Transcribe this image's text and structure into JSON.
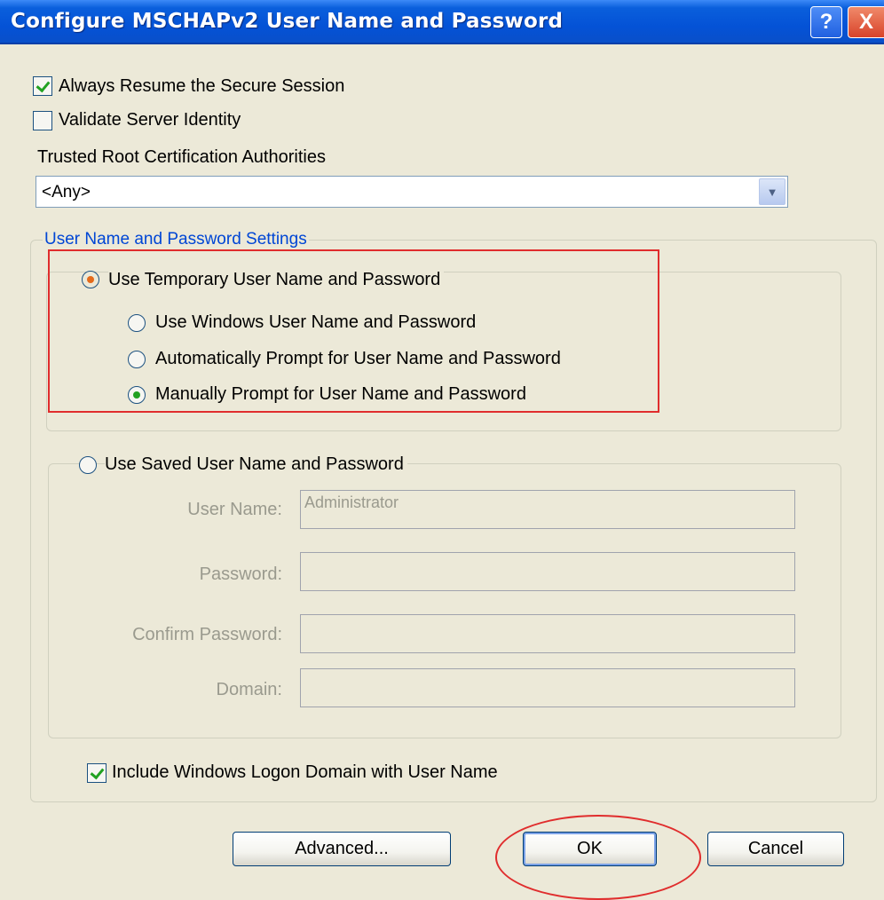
{
  "window": {
    "title": "Configure MSCHAPv2 User Name and Password",
    "help_icon": "?",
    "close_icon": "X"
  },
  "options": {
    "always_resume": {
      "label": "Always Resume the Secure Session",
      "checked": true
    },
    "validate_server": {
      "label": "Validate Server Identity",
      "checked": false
    }
  },
  "trusted_root": {
    "label": "Trusted Root Certification Authorities",
    "selected": "<Any>"
  },
  "settings_group": {
    "legend": "User Name and Password Settings",
    "use_temporary": {
      "label": "Use Temporary User Name and Password",
      "selected": true
    },
    "sub_options": [
      {
        "label": "Use Windows User Name and Password",
        "selected": false
      },
      {
        "label": "Automatically Prompt for User Name and Password",
        "selected": false
      },
      {
        "label": "Manually Prompt for User Name and Password",
        "selected": true
      }
    ],
    "use_saved": {
      "label": "Use Saved User Name and Password",
      "selected": false
    },
    "fields": {
      "user_name": {
        "label": "User Name:",
        "value": "Administrator"
      },
      "password": {
        "label": "Password:",
        "value": ""
      },
      "confirm_password": {
        "label": "Confirm Password:",
        "value": ""
      },
      "domain": {
        "label": "Domain:",
        "value": ""
      }
    },
    "include_domain": {
      "label": "Include Windows Logon Domain with User Name",
      "checked": true
    }
  },
  "buttons": {
    "advanced": "Advanced...",
    "ok": "OK",
    "cancel": "Cancel"
  },
  "colors": {
    "titlebar": "#0452d6",
    "dialog_bg": "#ece9d8",
    "legend_text": "#0046d5",
    "annotation_red": "#e02d2d",
    "check_green": "#21a121"
  }
}
